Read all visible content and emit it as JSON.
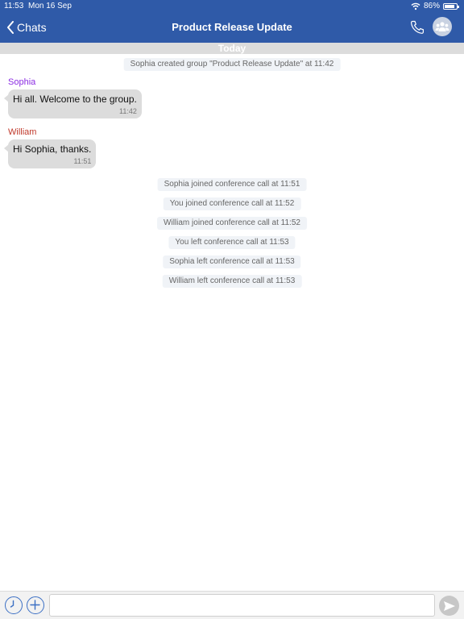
{
  "status_bar": {
    "time": "11:53",
    "date": "Mon 16 Sep",
    "battery": "86%",
    "battery_level": 0.86
  },
  "navbar": {
    "back_label": "Chats",
    "title": "Product Release Update"
  },
  "date_divider": "Today",
  "messages": {
    "created": "Sophia created group \"Product Release Update\" at 11:42",
    "m1": {
      "sender": "Sophia",
      "text": "Hi all. Welcome to the group.",
      "time": "11:42",
      "sender_color": "#8a2be2"
    },
    "m2": {
      "sender": "William",
      "text": "Hi Sophia, thanks.",
      "time": "11:51",
      "sender_color": "#c0392b"
    },
    "events": [
      "Sophia joined conference call at 11:51",
      "You joined conference call at 11:52",
      "William joined conference call at 11:52",
      "You left conference call at 11:53",
      "Sophia left conference call at 11:53",
      "William left conference call at 11:53"
    ]
  },
  "input": {
    "value": "",
    "placeholder": ""
  },
  "colors": {
    "navbar": "#2f5aa8",
    "accent": "#3b6fc4",
    "bubble": "#dcdcdc"
  },
  "icons": [
    "back-chevron-icon",
    "phone-icon",
    "group-avatar-icon",
    "clock-icon",
    "plus-icon",
    "send-icon",
    "wifi-icon",
    "battery-icon"
  ]
}
